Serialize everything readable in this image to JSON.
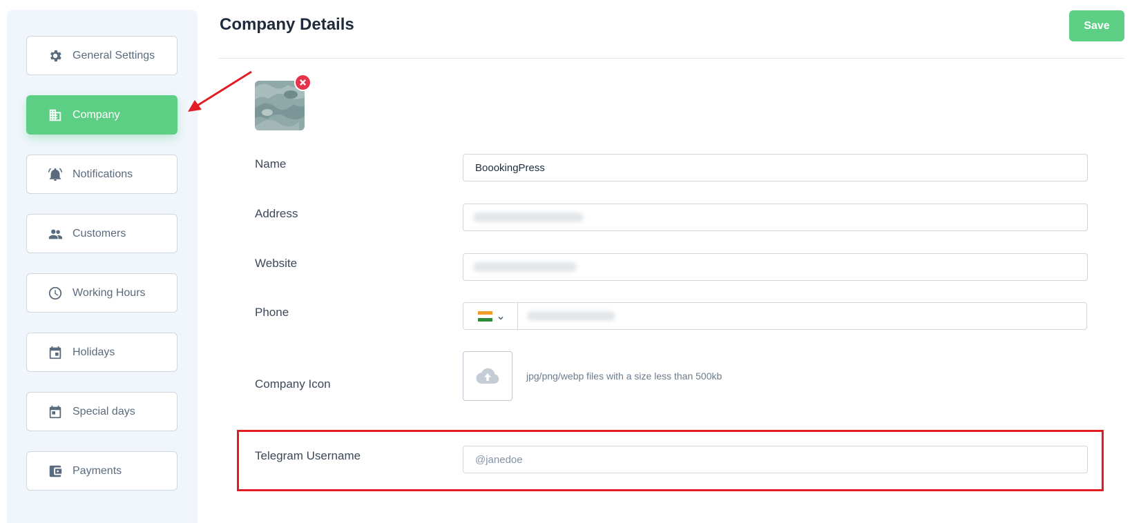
{
  "sidebar": {
    "items": [
      {
        "label": "General Settings",
        "icon": "gear-icon",
        "active": false
      },
      {
        "label": "Company",
        "icon": "building-icon",
        "active": true
      },
      {
        "label": "Notifications",
        "icon": "bell-icon",
        "active": false
      },
      {
        "label": "Customers",
        "icon": "users-icon",
        "active": false
      },
      {
        "label": "Working Hours",
        "icon": "clock-icon",
        "active": false
      },
      {
        "label": "Holidays",
        "icon": "calendar-icon",
        "active": false
      },
      {
        "label": "Special days",
        "icon": "calendar-icon",
        "active": false
      },
      {
        "label": "Payments",
        "icon": "wallet-icon",
        "active": false
      }
    ]
  },
  "header": {
    "title": "Company Details",
    "save_label": "Save"
  },
  "form": {
    "name_label": "Name",
    "name_value": "BoookingPress",
    "address_label": "Address",
    "website_label": "Website",
    "phone_label": "Phone",
    "phone_country": "India",
    "company_icon_label": "Company Icon",
    "upload_hint": "jpg/png/webp files with a size less than 500kb",
    "telegram_label": "Telegram Username",
    "telegram_placeholder": "@janedoe"
  },
  "colors": {
    "accent": "#5ccf85",
    "danger": "#e5344a",
    "annotation": "#e11d23"
  }
}
